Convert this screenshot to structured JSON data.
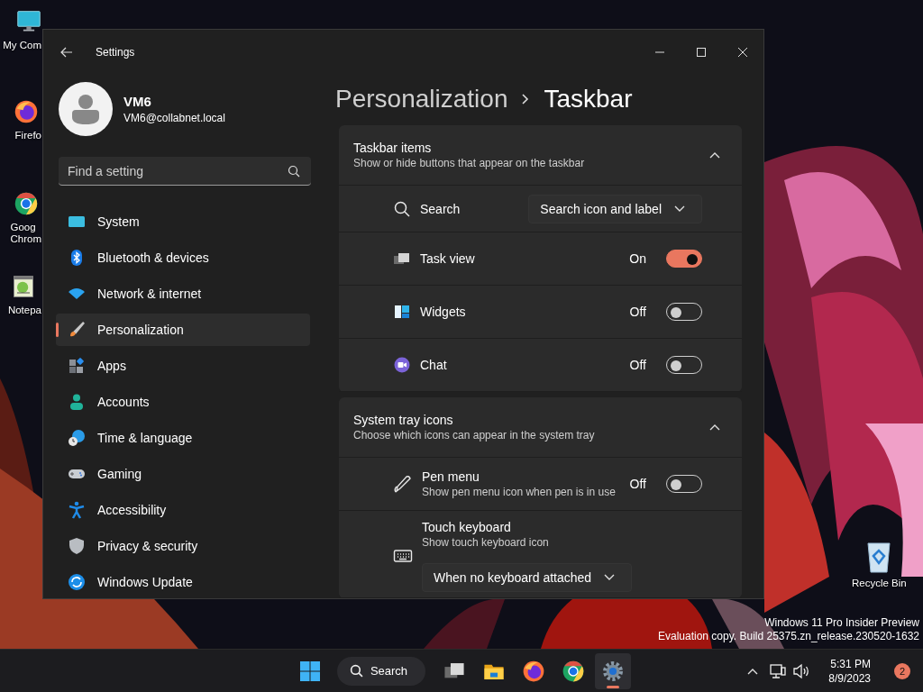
{
  "desktop": {
    "icons": [
      {
        "kind": "monitor",
        "label": "My Com"
      },
      {
        "kind": "firefox",
        "label": "Firefo"
      },
      {
        "kind": "chrome",
        "label": "Goog\nChrom"
      },
      {
        "kind": "notepad",
        "label": "Notepa"
      }
    ],
    "recycle_bin": {
      "label": "Recycle Bin"
    },
    "watermark": [
      "Windows 11 Pro Insider Preview",
      "Evaluation copy. Build 25375.zn_release.230520-1632"
    ]
  },
  "window": {
    "title": "Settings",
    "user": {
      "name": "VM6",
      "email": "VM6@collabnet.local"
    },
    "search": {
      "placeholder": "Find a setting"
    },
    "nav": [
      {
        "kind": "system",
        "label": "System",
        "selected": false
      },
      {
        "kind": "bluetooth",
        "label": "Bluetooth & devices",
        "selected": false
      },
      {
        "kind": "network",
        "label": "Network & internet",
        "selected": false
      },
      {
        "kind": "personalization",
        "label": "Personalization",
        "selected": true
      },
      {
        "kind": "apps",
        "label": "Apps",
        "selected": false
      },
      {
        "kind": "accounts",
        "label": "Accounts",
        "selected": false
      },
      {
        "kind": "time",
        "label": "Time & language",
        "selected": false
      },
      {
        "kind": "gaming",
        "label": "Gaming",
        "selected": false
      },
      {
        "kind": "accessibility",
        "label": "Accessibility",
        "selected": false
      },
      {
        "kind": "privacy",
        "label": "Privacy & security",
        "selected": false
      },
      {
        "kind": "update",
        "label": "Windows Update",
        "selected": false
      }
    ],
    "breadcrumb": [
      "Personalization",
      "Taskbar"
    ],
    "sections": [
      {
        "title": "Taskbar items",
        "subtitle": "Show or hide buttons that appear on the taskbar",
        "expanded": true,
        "items": [
          {
            "kind": "dropdown",
            "label": "Search",
            "value": "Search icon and label"
          },
          {
            "kind": "toggle",
            "label": "Task view",
            "on": true,
            "state_text": "On"
          },
          {
            "kind": "toggle",
            "label": "Widgets",
            "on": false,
            "state_text": "Off"
          },
          {
            "kind": "toggle",
            "label": "Chat",
            "on": false,
            "state_text": "Off"
          }
        ]
      },
      {
        "title": "System tray icons",
        "subtitle": "Choose which icons can appear in the system tray",
        "expanded": true,
        "items": [
          {
            "kind": "toggle",
            "label": "Pen menu",
            "description": "Show pen menu icon when pen is in use",
            "on": false,
            "state_text": "Off"
          },
          {
            "kind": "dropdown_below",
            "label": "Touch keyboard",
            "description": "Show touch keyboard icon",
            "value": "When no keyboard attached"
          }
        ]
      }
    ]
  },
  "taskbar": {
    "search": "Search",
    "apps": [
      {
        "kind": "taskview",
        "active": false
      },
      {
        "kind": "explorer",
        "active": false
      },
      {
        "kind": "firefox",
        "active": false
      },
      {
        "kind": "chrome",
        "active": false
      },
      {
        "kind": "settings",
        "active": true
      }
    ],
    "time": "5:31 PM",
    "date": "8/9/2023",
    "notification_count": "2"
  }
}
